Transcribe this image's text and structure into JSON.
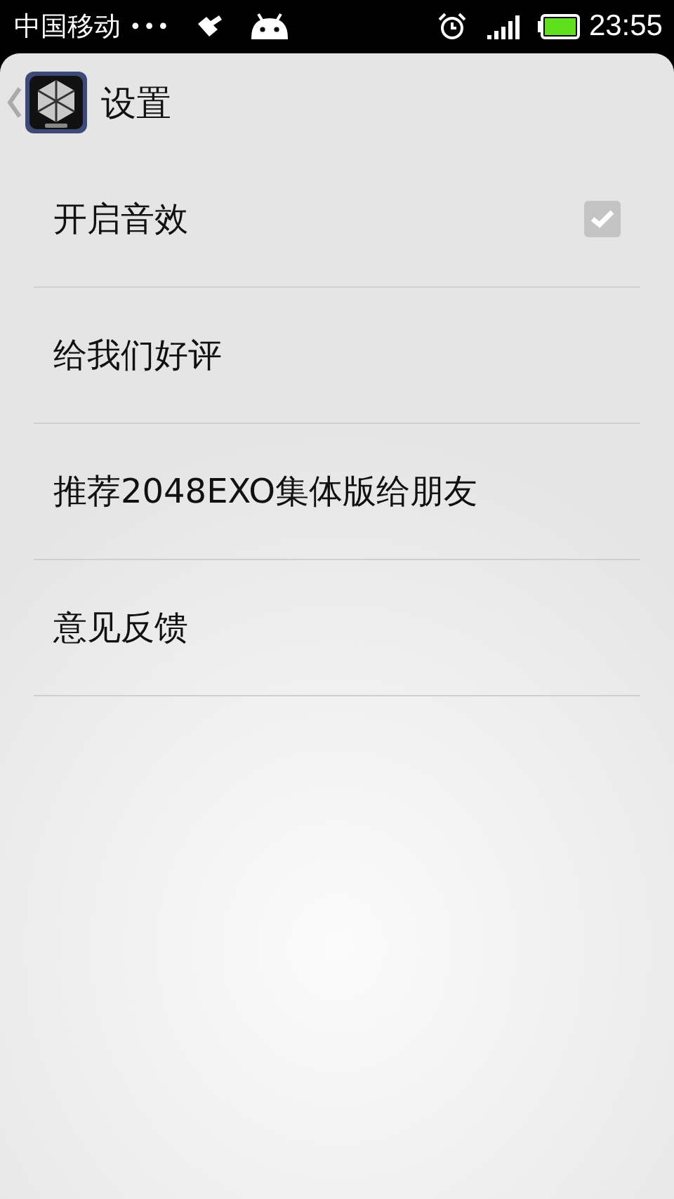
{
  "status_bar": {
    "carrier": "中国移动",
    "dots": "•••",
    "time": "23:55"
  },
  "header": {
    "title": "设置"
  },
  "settings": [
    {
      "kind": "checkbox",
      "label": "开启音效",
      "checked": true
    },
    {
      "kind": "link",
      "label": "给我们好评"
    },
    {
      "kind": "link",
      "label": "推荐2048EXO集体版给朋友"
    },
    {
      "kind": "link",
      "label": "意见反馈"
    }
  ]
}
